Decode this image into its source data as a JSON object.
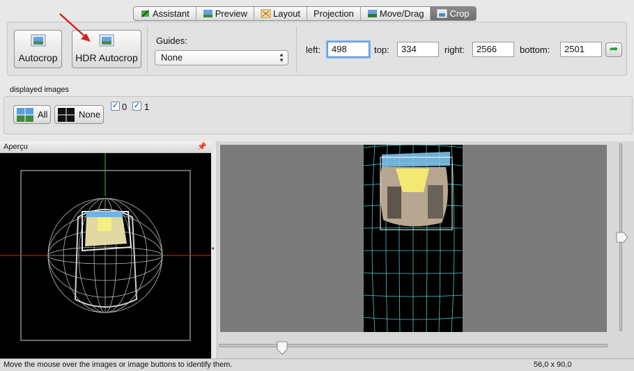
{
  "tabs": [
    {
      "label": "Assistant",
      "icon": "wand-icon"
    },
    {
      "label": "Preview",
      "icon": "landscape-icon"
    },
    {
      "label": "Layout",
      "icon": "layout-icon"
    },
    {
      "label": "Projection",
      "icon": ""
    },
    {
      "label": "Move/Drag",
      "icon": "move-icon"
    },
    {
      "label": "Crop",
      "icon": "crop-icon"
    }
  ],
  "crop": {
    "autocrop_label": "Autocrop",
    "hdr_autocrop_label": "HDR Autocrop",
    "guides_label": "Guides:",
    "guides_value": "None",
    "left_label": "left:",
    "left_value": "498",
    "top_label": "top:",
    "top_value": "334",
    "right_label": "right:",
    "right_value": "2566",
    "bottom_label": "bottom:",
    "bottom_value": "2501"
  },
  "displayed": {
    "section_label": "displayed images",
    "all_label": "All",
    "none_label": "None",
    "images": [
      {
        "label": "0",
        "checked": true
      },
      {
        "label": "1",
        "checked": true
      }
    ]
  },
  "preview_panel": {
    "title": "Aperçu",
    "pin_icon": "pin-icon"
  },
  "statusbar": {
    "message": "Move the mouse over the images or image buttons to identify them.",
    "fov": "56,0 x 90,0"
  },
  "colors": {
    "active_tab": "#787878",
    "annotation_arrow": "#d42020",
    "grid": "#5fd0d0",
    "green_action": "#2e9c2a"
  }
}
